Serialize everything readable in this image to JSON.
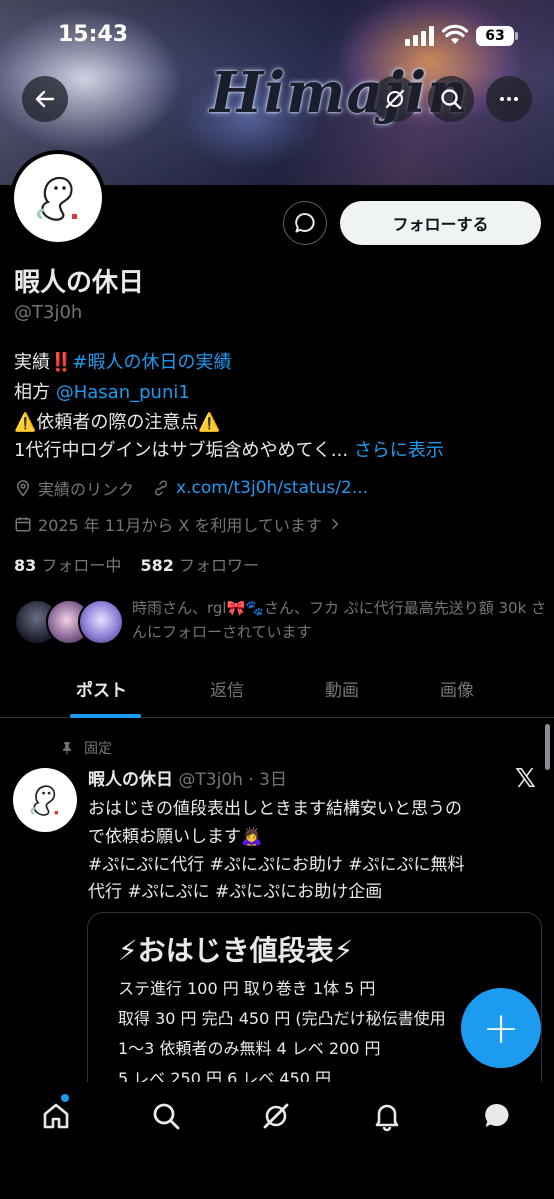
{
  "status_bar": {
    "time": "15:43",
    "battery": "63"
  },
  "banner": {
    "logo_text": "Himajin"
  },
  "header_buttons": {
    "back": "back-icon",
    "grok": "grok-icon",
    "search": "search-icon",
    "more": "more-icon"
  },
  "profile": {
    "name": "暇人の休日",
    "handle": "@T3j0h",
    "follow_label": "フォローする",
    "bio": {
      "line1_prefix": "実績",
      "line1_emoji": "‼️",
      "line1_hashtag": "#暇人の休日の実績",
      "line2_prefix": "相方",
      "line2_mention": "@Hasan_puni1",
      "line3": "⚠️依頼者の際の注意点⚠️",
      "line4": "1代行中ログインはサブ垢含めやめてく...",
      "show_more": "さらに表示"
    },
    "link_label": "実績のリンク",
    "link_url": "x.com/t3j0h/status/2...",
    "joined": "2025 年 11月から X を利用しています",
    "following_count": "83",
    "following_label": "フォロー中",
    "followers_count": "582",
    "followers_label": "フォロワー",
    "followed_by": "時雨さん、rgl🎀🐾さん、フカ ぷに代行最高先送り額 30k さんにフォローされています"
  },
  "tabs": [
    "ポスト",
    "返信",
    "動画",
    "画像"
  ],
  "active_tab": "ポスト",
  "pinned_post": {
    "pinned_label": "固定",
    "author": "暇人の休日",
    "handle_time": "@T3j0h · 3日",
    "text_line1": "おはじきの値段表出しときます結構安いと思うの",
    "text_line2": "で依頼お願いします🙇‍♀️",
    "hashtags_line1": "#ぷにぷに代行  #ぷにぷにお助け  #ぷにぷに無料",
    "hashtags_line2": "代行  #ぷにぷに  #ぷにぷにお助け企画",
    "card": {
      "title": "⚡おはじき値段表⚡",
      "lines": [
        "ステ進行 100 円 取り巻き 1体 5 円",
        "取得 30 円 完凸 450 円 (完凸だけ秘伝書使用",
        "1～3 依頼者のみ無料 4 レベ 200 円",
        "5 レベ 250 円 6 レベ 450 円"
      ]
    }
  },
  "fab_label": "+",
  "bottom_nav": [
    "home-icon",
    "search-icon",
    "grok-icon",
    "notifications-icon",
    "messages-icon"
  ],
  "colors": {
    "accent": "#1d9bf0",
    "background": "#000000",
    "muted": "#71767b",
    "text": "#e7e9ea"
  }
}
